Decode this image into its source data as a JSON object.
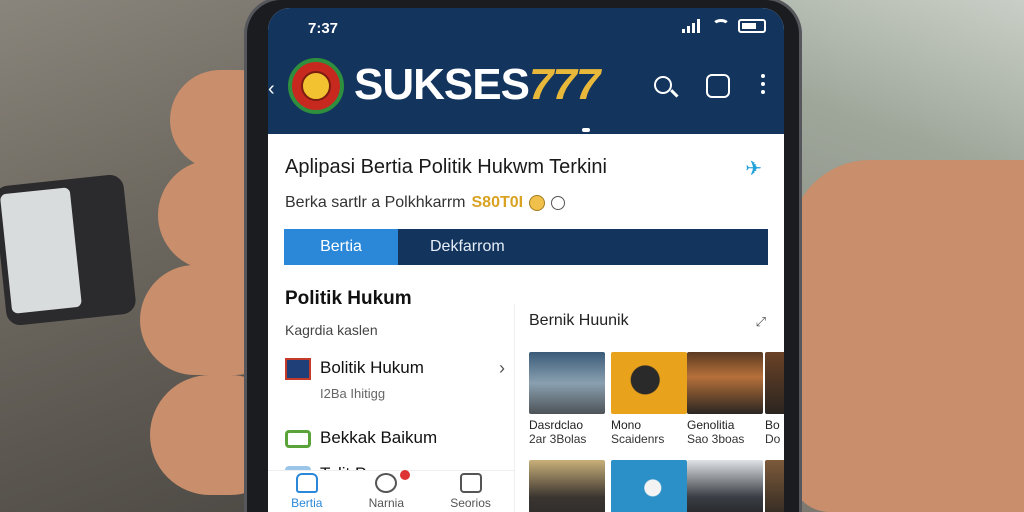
{
  "status_bar": {
    "time": "7:37"
  },
  "header": {
    "brand_text": "SUKSES",
    "brand_number": "777"
  },
  "intro": {
    "title": "Aplipasi Bertia Politik Hukwm Terkini",
    "subline_text": "Berka sartlr a Polkhkarrm",
    "subline_code": "S80T0I"
  },
  "tabs": [
    {
      "label": "Bertia",
      "active": true
    },
    {
      "label": "Dekfarrom",
      "active": false
    }
  ],
  "left_panel": {
    "heading": "Politik Hukum",
    "subheading": "Kagrdia kaslen",
    "items": [
      {
        "label": "Bolitik Hukum",
        "meta": "I2Ba Ihitigg"
      },
      {
        "label": "Bekkak Baikum",
        "meta": ""
      },
      {
        "label": "Tolit Pracon",
        "meta": ""
      }
    ]
  },
  "right_panel": {
    "heading": "Bernik Huunik",
    "cards": [
      {
        "title": "Dasrdclao",
        "sub": "2ar 3Bolas"
      },
      {
        "title": "Mono",
        "sub": "Scaidenrs"
      },
      {
        "title": "Genolitia",
        "sub": "Sao 3boas"
      },
      {
        "title": "Bo",
        "sub": "Do"
      }
    ]
  },
  "bottom_nav": [
    {
      "label": "Bertia",
      "icon": "home-icon",
      "active": true
    },
    {
      "label": "Narnia",
      "icon": "bell-icon",
      "active": false
    },
    {
      "label": "Seorios",
      "icon": "chat-icon",
      "active": false
    }
  ],
  "colors": {
    "header_bg": "#12345d",
    "accent": "#2b88d8",
    "brand_gold": "#e8b83a"
  }
}
